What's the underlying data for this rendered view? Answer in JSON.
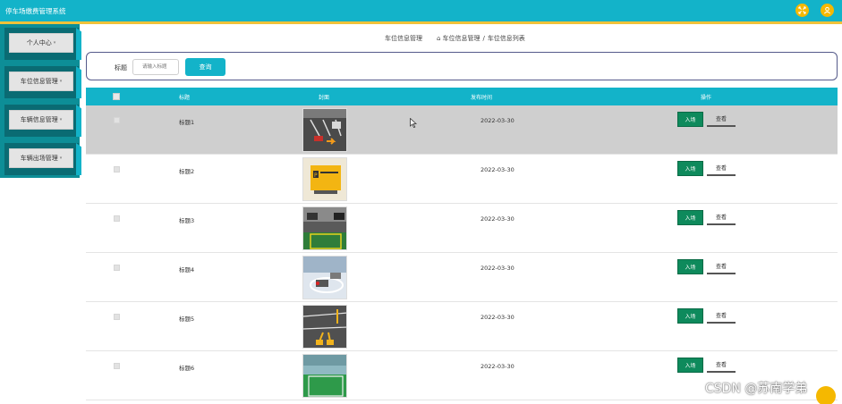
{
  "app": {
    "title": "停车场缴费管理系统"
  },
  "header_icons": [
    "fullscreen-icon",
    "user-icon"
  ],
  "colors": {
    "primary": "#13b3c9",
    "accent": "#f0c23a",
    "sidebar": "#0d8e97",
    "entry_button": "#0e8a5c",
    "highlight_row": "#cfcfcf"
  },
  "sidebar": {
    "items": [
      {
        "label": "个人中心"
      },
      {
        "label": "车位信息管理"
      },
      {
        "label": "车辆信息管理"
      },
      {
        "label": "车辆出场管理"
      }
    ]
  },
  "breadcrumb": {
    "section": "车位信息管理",
    "path": [
      "车位信息管理",
      "车位信息列表"
    ]
  },
  "search": {
    "label": "标题",
    "placeholder": "请输入标题",
    "button": "查询"
  },
  "table": {
    "columns": [
      "",
      "标题",
      "封面",
      "发布时间",
      "操作"
    ],
    "rows": [
      {
        "title": "标题1",
        "date": "2022-03-30",
        "action_in": "入场",
        "action_view": "查看"
      },
      {
        "title": "标题2",
        "date": "2022-03-30",
        "action_in": "入场",
        "action_view": "查看"
      },
      {
        "title": "标题3",
        "date": "2022-03-30",
        "action_in": "入场",
        "action_view": "查看"
      },
      {
        "title": "标题4",
        "date": "2022-03-30",
        "action_in": "入场",
        "action_view": "查看"
      },
      {
        "title": "标题5",
        "date": "2022-03-30",
        "action_in": "入场",
        "action_view": "查看"
      },
      {
        "title": "标题6",
        "date": "2022-03-30",
        "action_in": "入场",
        "action_view": "查看"
      }
    ]
  },
  "watermark": "CSDN @苏南学弟"
}
